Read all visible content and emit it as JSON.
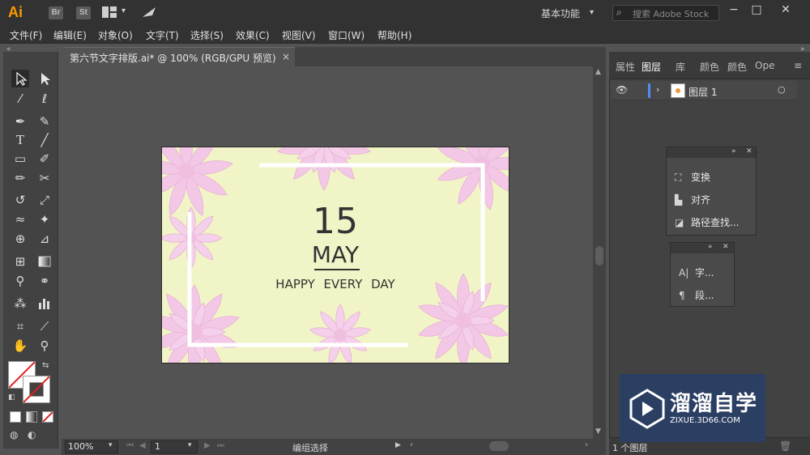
{
  "app": {
    "logo": "Ai",
    "badges": [
      "Br",
      "St"
    ],
    "workspace": "基本功能",
    "stock_search_placeholder": "搜索 Adobe Stock"
  },
  "menu": [
    "文件(F)",
    "编辑(E)",
    "对象(O)",
    "文字(T)",
    "选择(S)",
    "效果(C)",
    "视图(V)",
    "窗口(W)",
    "帮助(H)"
  ],
  "document": {
    "tab_title": "第六节文字排版.ai* @ 100% (RGB/GPU 预览)",
    "close": "×"
  },
  "artwork": {
    "day": "15",
    "month": "MAY",
    "slogan": "HAPPY EVERY DAY",
    "background_color": "#f1f4c6",
    "flower_color": "#f3c8e6"
  },
  "status": {
    "zoom": "100%",
    "page": "1",
    "tool": "编组选择"
  },
  "panel": {
    "tabs": [
      "属性",
      "图层",
      "库",
      "颜色",
      "颜色",
      "Ope"
    ],
    "active_tab": "图层",
    "layer_name": "图层 1",
    "layer_count": "1 个图层"
  },
  "float_panel_1": {
    "items": [
      "变换",
      "对齐",
      "路径查找..."
    ]
  },
  "float_panel_2": {
    "items": [
      "字...",
      "段..."
    ]
  },
  "watermark": {
    "title": "溜溜自学",
    "url": "ZIXUE.3D66.COM"
  }
}
